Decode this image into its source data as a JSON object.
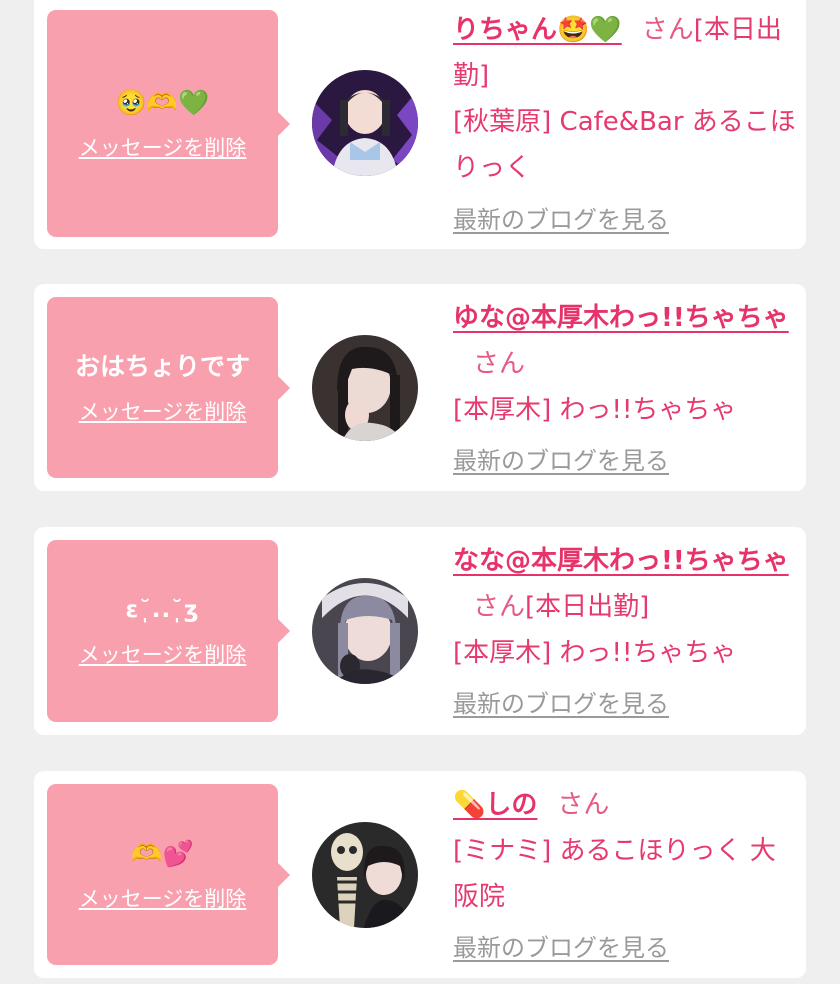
{
  "common": {
    "delete_label": "メッセージを削除",
    "blog_label": "最新のブログを見る",
    "honorific": "さん"
  },
  "cards": [
    {
      "message": "🥹🫶💚",
      "name": "りちゃん🤩💚",
      "status": "[本日出勤]",
      "shop": "[秋葉原] Cafe&Bar あるこほりっく"
    },
    {
      "message": "おはちょりです",
      "name": "ゆな@本厚木わっ!!ちゃちゃ",
      "status": "",
      "shop": "[本厚木] わっ!!ちゃちゃ"
    },
    {
      "message": "ε˘̩..˘̩ʒ",
      "name": "なな@本厚木わっ!!ちゃちゃ",
      "status": "[本日出勤]",
      "shop": "[本厚木] わっ!!ちゃちゃ"
    },
    {
      "message": "🫶💕",
      "name": "💊しの",
      "status": "",
      "shop": "[ミナミ] あるこほりっく 大阪院"
    }
  ],
  "colors": {
    "bubble": "#f9a0af",
    "name": "#e6336a",
    "text": "#e63a6e",
    "blog_link": "#9a9a9a",
    "background": "#efefef"
  },
  "icons": [
    "avatar-photo"
  ]
}
